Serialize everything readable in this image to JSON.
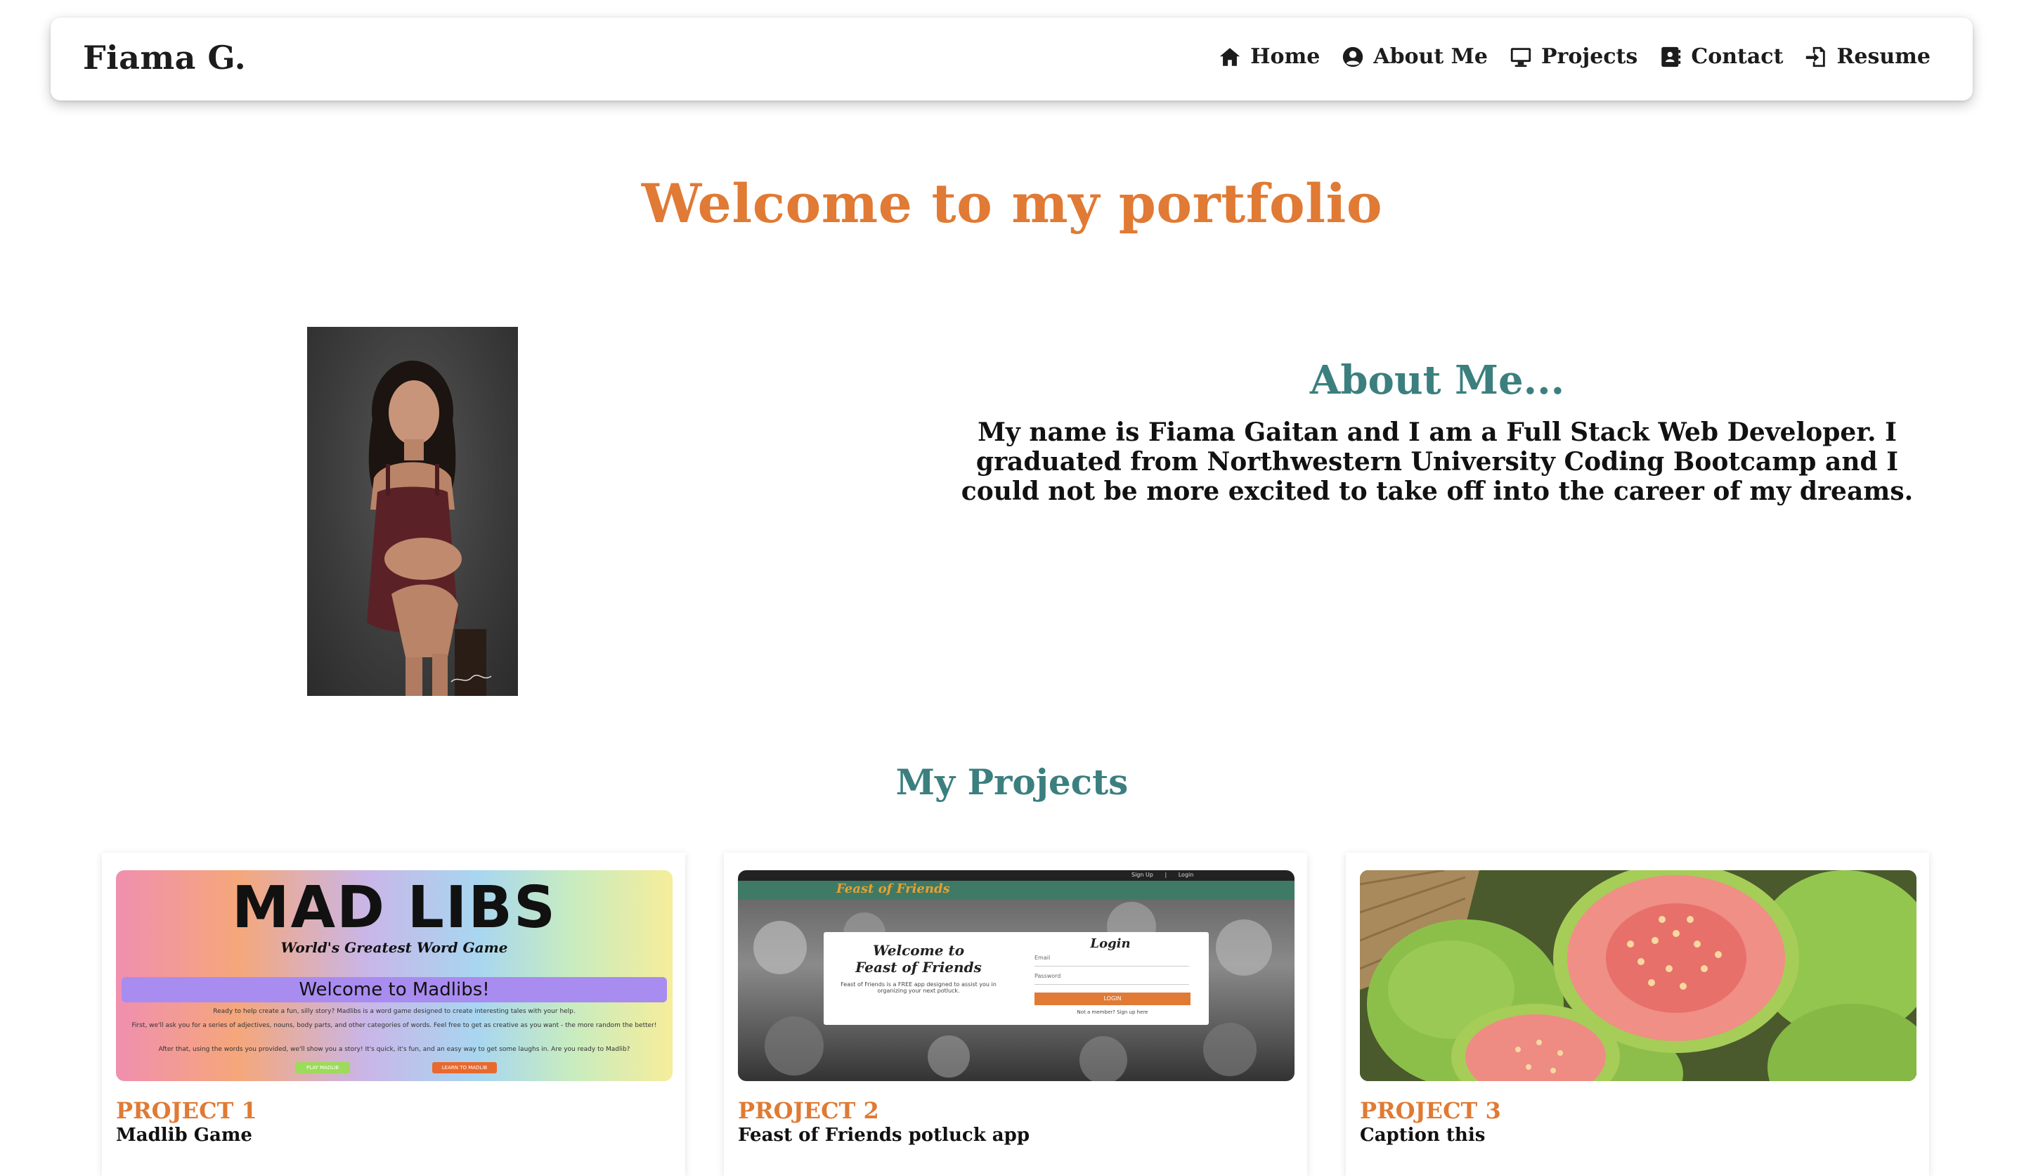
{
  "nav": {
    "brand": "Fiama G.",
    "links": [
      {
        "label": "Home",
        "icon": "home-icon"
      },
      {
        "label": "About Me",
        "icon": "user-circle-icon"
      },
      {
        "label": "Projects",
        "icon": "desktop-icon"
      },
      {
        "label": "Contact",
        "icon": "contact-card-icon"
      },
      {
        "label": "Resume",
        "icon": "file-import-icon"
      }
    ]
  },
  "hero": {
    "headline": "Welcome to my portfolio"
  },
  "about": {
    "title": "About Me...",
    "text": "My name is Fiama Gaitan and I am a Full Stack Web Developer. I graduated from Northwestern University Coding Bootcamp and I could not be more excited to take off into the career of my dreams."
  },
  "projects": {
    "title": "My Projects",
    "items": [
      {
        "label": "PROJECT 1",
        "subtitle": "Madlib Game",
        "thumb": {
          "logo": "MAD LIBS",
          "tagline": "World's Greatest Word Game",
          "welcome": "Welcome to Madlibs!",
          "line1": "Ready to help create a fun, silly story? Madlibs is a word game designed to create interesting tales with your help.",
          "line2": "First, we'll ask you for a series of adjectives, nouns, body parts, and other categories of words. Feel free to get as creative as you want - the more random the better!",
          "line3": "After that, using the words you provided, we'll show you a story! It's quick, it's fun, and an easy way to get some laughs in. Are you ready to Madlib?",
          "btn1": "PLAY MADLIB",
          "btn2": "LEARN TO MADLIB"
        }
      },
      {
        "label": "PROJECT 2",
        "subtitle": "Feast of Friends potluck app",
        "thumb": {
          "brand": "Feast of Friends",
          "signup": "Sign Up",
          "login": "Login",
          "welcome1": "Welcome to",
          "welcome2": "Feast of Friends",
          "blurb": "Feast of Friends is a FREE app designed to assist you in organizing your next potluck.",
          "login_title": "Login",
          "email": "Email",
          "password": "Password",
          "login_btn": "LOGIN",
          "member": "Not a member? Sign up here"
        }
      },
      {
        "label": "PROJECT 3",
        "subtitle": "Caption this"
      }
    ]
  },
  "colors": {
    "accent": "#e07a34",
    "teal": "#3b7f7f",
    "text": "#111111"
  }
}
